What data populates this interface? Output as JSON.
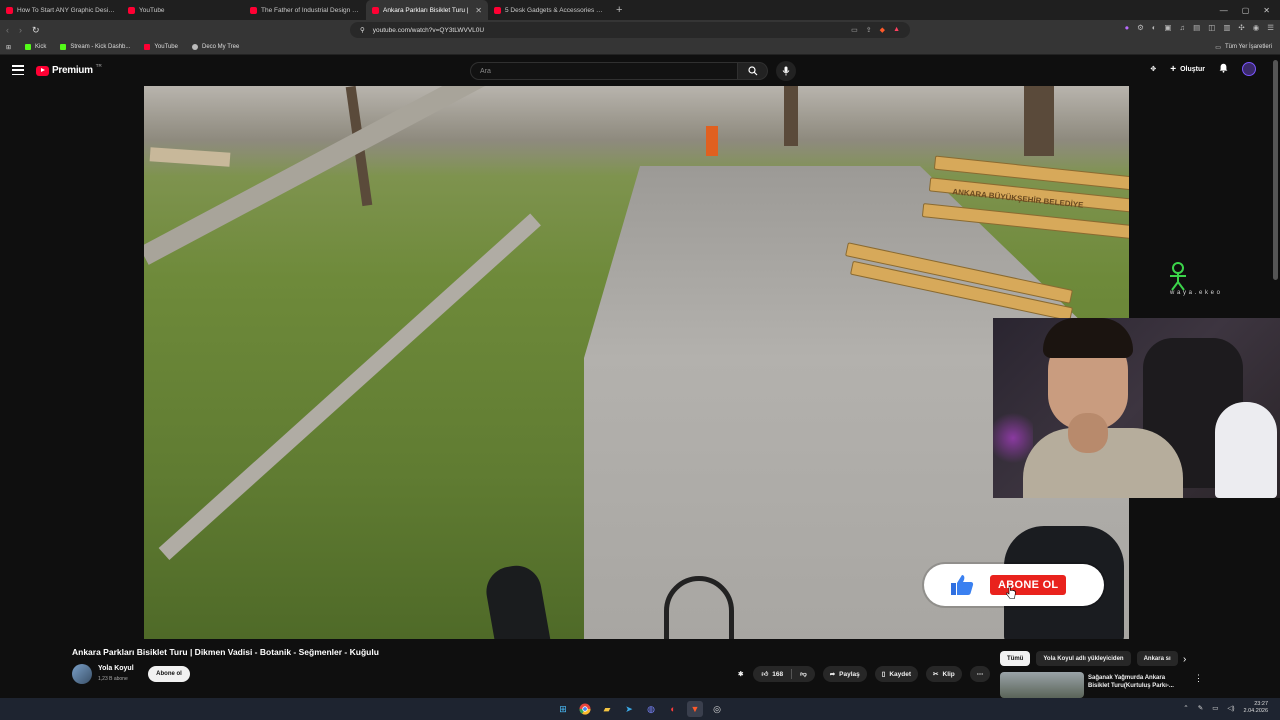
{
  "browser": {
    "tabs": [
      {
        "title": "How To Start ANY Graphic Design Fr",
        "active": false
      },
      {
        "title": "YouTube",
        "active": false
      },
      {
        "title": "The Father of Industrial Design | Dier",
        "active": false
      },
      {
        "title": "Ankara Parkları Bisiklet Turu |",
        "active": true
      },
      {
        "title": "5 Desk Gadgets & Accessories Unde",
        "active": false
      }
    ],
    "url": "youtube.com/watch?v=QY3tLWVVL0U",
    "bookmarks": [
      "Kick",
      "Stream - Kick Dashb...",
      "YouTube",
      "Deco My Tree"
    ],
    "bookmarks_right": "Tüm Yer İşaretleri"
  },
  "youtube": {
    "logo_text": "Premium",
    "logo_sup": "TR",
    "search_placeholder": "Ara",
    "create_label": "Oluştur"
  },
  "video": {
    "title": "Ankara Parkları Bisiklet Turu | Dikmen Vadisi - Botanik - Seğmenler - Kuğulu",
    "bench_text": "ANKARA BÜYÜKŞEHİR BELEDİYE",
    "watermark": "w a y a . e k e o",
    "overlay_subscribe": "ABONE OL"
  },
  "channel": {
    "name": "Yola Koyul",
    "subscribers": "1,23 B abone",
    "subscribe_label": "Abone ol"
  },
  "actions": {
    "likes": "168",
    "share": "Paylaş",
    "save": "Kaydet",
    "clip": "Klip"
  },
  "sidebar": {
    "chips": [
      "Tümü",
      "Yola Koyul adlı yükleyiciden",
      "Ankara sı"
    ],
    "rec_title": "Sağanak Yağmurda Ankara Bisiklet Turu(Kurtuluş Parkı-..."
  },
  "taskbar": {
    "time": "23:27",
    "date": "2.04.2026"
  },
  "colors": {
    "yt_red": "#ff0033",
    "bg": "#0f0f0f",
    "subscribe_red": "#e9221d"
  }
}
